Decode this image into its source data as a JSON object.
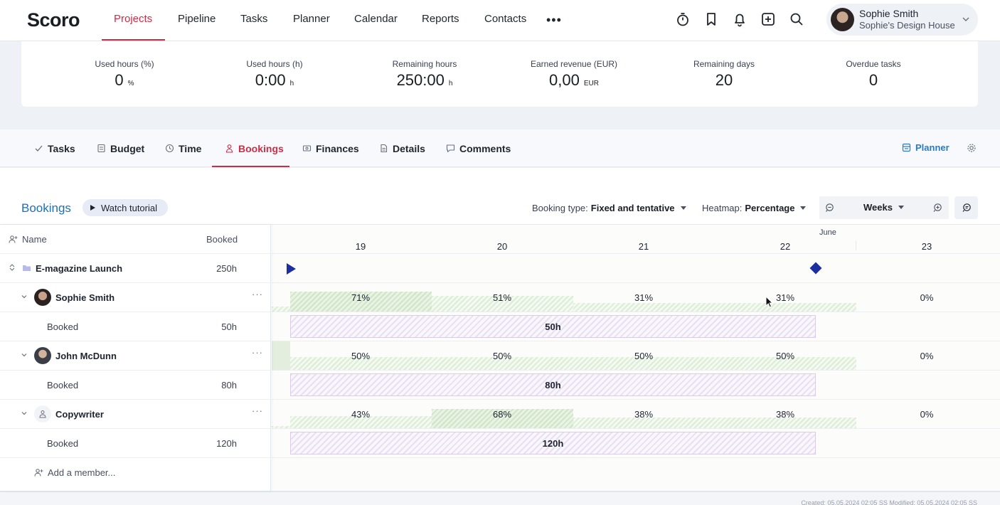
{
  "brand": {
    "name": "Scoro",
    "accent": "#d02c46"
  },
  "nav": {
    "items": [
      {
        "label": "Projects",
        "active": true
      },
      {
        "label": "Pipeline"
      },
      {
        "label": "Tasks"
      },
      {
        "label": "Planner"
      },
      {
        "label": "Calendar"
      },
      {
        "label": "Reports"
      },
      {
        "label": "Contacts"
      }
    ],
    "more": "•••",
    "icons": [
      "stopwatch-icon",
      "bookmark-icon",
      "bell-icon",
      "plus-square-icon",
      "search-icon"
    ]
  },
  "user": {
    "name": "Sophie Smith",
    "company": "Sophie's Design House"
  },
  "stats": [
    {
      "label": "Used hours (%)",
      "value": "0",
      "unit": "%"
    },
    {
      "label": "Used hours (h)",
      "value": "0:00",
      "unit": "h"
    },
    {
      "label": "Remaining hours",
      "value": "250:00",
      "unit": "h"
    },
    {
      "label": "Earned revenue (EUR)",
      "value": "0,00",
      "unit": "EUR"
    },
    {
      "label": "Remaining days",
      "value": "20",
      "unit": ""
    },
    {
      "label": "Overdue tasks",
      "value": "0",
      "unit": ""
    }
  ],
  "tabs": [
    {
      "label": "Tasks",
      "icon": "check-icon"
    },
    {
      "label": "Budget",
      "icon": "budget-icon"
    },
    {
      "label": "Time",
      "icon": "clock-icon"
    },
    {
      "label": "Bookings",
      "icon": "person-icon",
      "active": true
    },
    {
      "label": "Finances",
      "icon": "finances-icon"
    },
    {
      "label": "Details",
      "icon": "document-icon"
    },
    {
      "label": "Comments",
      "icon": "comment-icon"
    }
  ],
  "planner_link": "Planner",
  "bookings": {
    "title": "Bookings",
    "watch_tutorial": "Watch tutorial",
    "booking_type_label": "Booking type:",
    "booking_type_value": "Fixed and tentative",
    "heatmap_label": "Heatmap:",
    "heatmap_value": "Percentage",
    "scale": "Weeks",
    "columns": {
      "name": "Name",
      "booked": "Booked"
    },
    "month": "June",
    "weeks": [
      "19",
      "20",
      "21",
      "22",
      "23"
    ],
    "project": {
      "name": "E-magazine Launch",
      "booked": "250h"
    },
    "members": [
      {
        "name": "Sophie Smith",
        "heat": [
          "71%",
          "51%",
          "31%",
          "31%",
          "0%"
        ],
        "booked_label": "Booked",
        "booked": "50h",
        "bar": "50h"
      },
      {
        "name": "John McDunn",
        "heat": [
          "50%",
          "50%",
          "50%",
          "50%",
          "0%"
        ],
        "booked_label": "Booked",
        "booked": "80h",
        "bar": "80h"
      },
      {
        "name": "Copywriter",
        "heat": [
          "43%",
          "68%",
          "38%",
          "38%",
          "0%"
        ],
        "booked_label": "Booked",
        "booked": "120h",
        "bar": "120h"
      }
    ],
    "add_member": "Add a member..."
  },
  "footer": {
    "text": "Created: 05.05.2024 02:05 SS     Modified: 05.05.2024 02:05 SS"
  }
}
